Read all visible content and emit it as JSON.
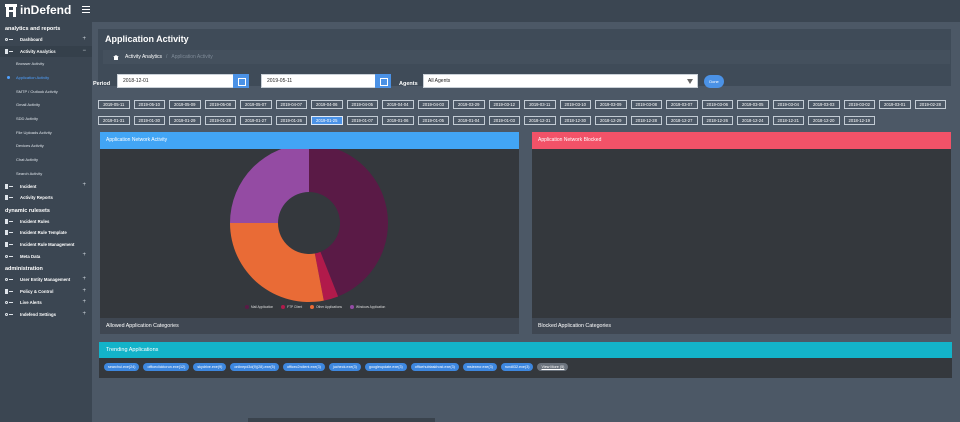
{
  "app": {
    "brand": "inDefend"
  },
  "sidebar": {
    "sections": [
      {
        "title": "analytics and reports",
        "items": [
          {
            "label": "Dashboard",
            "plus": "+"
          },
          {
            "label": "Activity Analytics",
            "plus": "−"
          }
        ]
      },
      {
        "title": "dynamic rulesets",
        "items": [
          {
            "label": "Incident Rules"
          },
          {
            "label": "Incident Rule Template"
          },
          {
            "label": "Incident Rule Management"
          },
          {
            "label": "Meta Data",
            "plus": "+"
          }
        ]
      },
      {
        "title": "administration",
        "items": [
          {
            "label": "User Entity Management",
            "plus": "+"
          },
          {
            "label": "Policy & Control",
            "plus": "+"
          },
          {
            "label": "Live Alerts",
            "plus": "+"
          },
          {
            "label": "Indefend Settings",
            "plus": "+"
          }
        ]
      }
    ],
    "subitems": [
      "Browser Activity",
      "Application Activity",
      "SMTP / Outlook Activity",
      "Gmail Activity",
      "SDD Activity",
      "File Uploads Activity",
      "Devices Activity",
      "Chat Activity",
      "Search Activity"
    ],
    "after": [
      {
        "label": "Incident",
        "plus": "+"
      },
      {
        "label": "Activity Reports"
      }
    ]
  },
  "page": {
    "title": "Application Activity",
    "breadcrumb": [
      "Activity Analytics",
      "/",
      "Application Activity"
    ]
  },
  "filter": {
    "period_label": "Period",
    "start_date": "2018-12-01",
    "end_date": "2019-05-11",
    "agents_label": "Agents",
    "agent_value": "All Agents",
    "done_label": "Done"
  },
  "dates": [
    "2019-05-11",
    "2019-05-10",
    "2019-05-09",
    "2019-05-08",
    "2019-05-07",
    "2019-04-07",
    "2019-04-06",
    "2019-04-05",
    "2019-04-04",
    "2019-04-03",
    "2019-03-29",
    "2019-03-12",
    "2019-03-11",
    "2019-03-10",
    "2019-03-09",
    "2019-03-08",
    "2019-03-07",
    "2019-03-06",
    "2019-03-05",
    "2019-03-04",
    "2019-03-03",
    "2019-03-02",
    "2019-03-01",
    "2019-02-28",
    "2019-01-31",
    "2019-01-30",
    "2019-01-29",
    "2019-01-28",
    "2019-01-27",
    "2019-01-26",
    "2019-01-25",
    "2019-01-07",
    "2019-01-06",
    "2019-01-05",
    "2019-01-04",
    "2019-01-03",
    "2018-12-31",
    "2018-12-30",
    "2018-12-29",
    "2018-12-28",
    "2018-12-27",
    "2018-12-26",
    "2018-12-24",
    "2018-12-21",
    "2018-12-20",
    "2018-12-19"
  ],
  "selected_date_index": 30,
  "panels": {
    "allowed": {
      "title": "Application Network Activity",
      "footer": "Allowed Application Categories",
      "color": "#42a5f5"
    },
    "blocked": {
      "title": "Application Network Blocked",
      "footer": "Blocked Application Categories",
      "color": "#f25268"
    }
  },
  "chart_data": {
    "type": "pie",
    "categories": [
      "Mail Application",
      "FTP Client",
      "Other Applications",
      "Windows Application"
    ],
    "values": [
      44,
      3,
      28,
      25
    ],
    "colors": [
      "#5a1a46",
      "#b11a4b",
      "#e96b36",
      "#944ba3"
    ]
  },
  "trending": {
    "title": "Trending Applications",
    "tags": [
      "searchui.exe(24)",
      "officeclicktorun.exe(12)",
      "skydrive.exe(9)",
      "onlinepd3d(9)(28).exe(5)",
      "officec2rclient.exe(3)",
      "jucheck.exe(3)",
      "googleupdate.exe(3)",
      "officehubtaskhost.exe(3)",
      "msiexecr.exe(3)",
      "rundll32.exe(3)"
    ],
    "more": "View More (5)"
  }
}
